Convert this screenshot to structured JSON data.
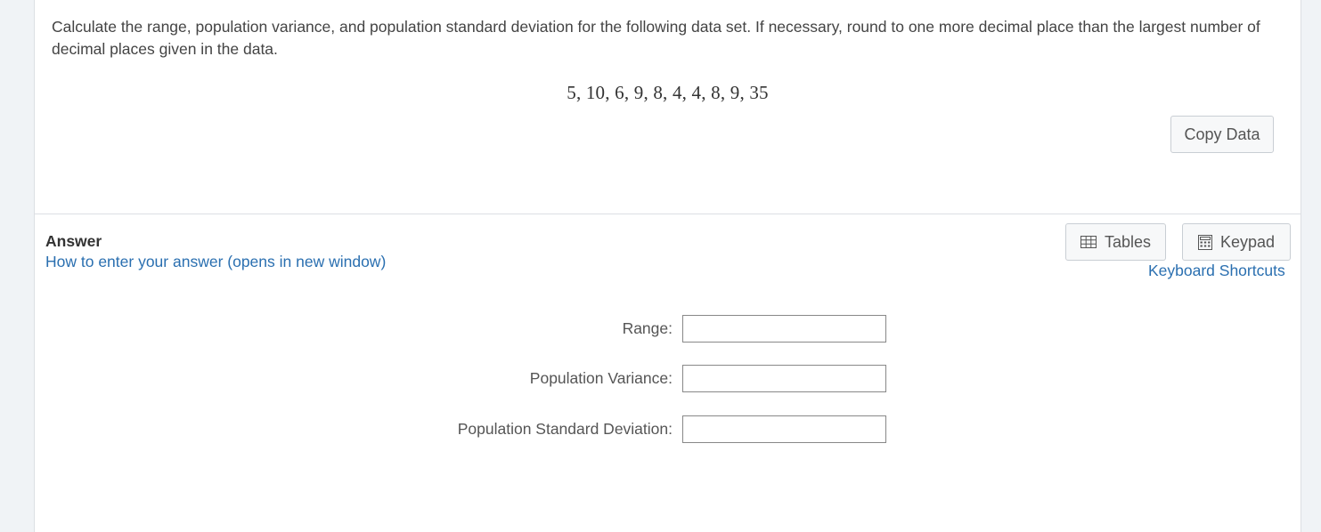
{
  "question": {
    "text": "Calculate the range, population variance, and population standard deviation for the following data set. If necessary, round to one more decimal place than the largest number of decimal places given in the data.",
    "dataset": "5, 10, 6, 9, 8, 4, 4, 8, 9, 35",
    "copy_button": "Copy Data"
  },
  "answer": {
    "heading": "Answer",
    "howto_link": "How to enter your answer (opens in new window)",
    "tables_button": "Tables",
    "keypad_button": "Keypad",
    "shortcuts_link": "Keyboard Shortcuts",
    "fields": [
      {
        "label": "Range:",
        "value": ""
      },
      {
        "label": "Population Variance:",
        "value": ""
      },
      {
        "label": "Population Standard Deviation:",
        "value": ""
      }
    ]
  },
  "colors": {
    "link": "#2a6fb0",
    "background": "#f0f3f6"
  }
}
